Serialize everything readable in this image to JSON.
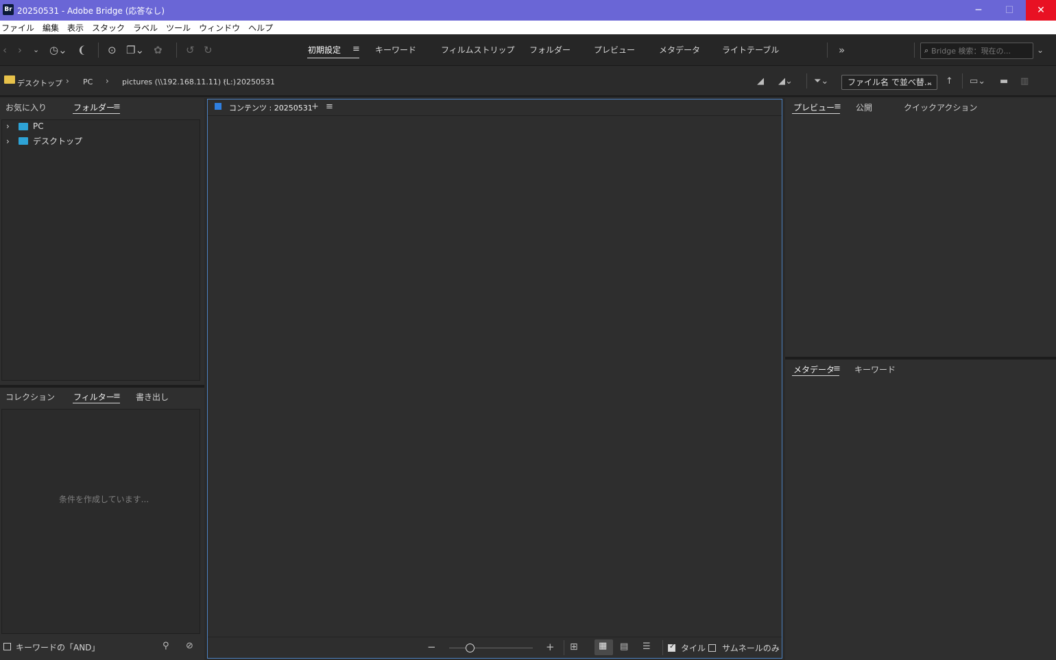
{
  "window": {
    "app_icon": "Br",
    "title": "20250531 - Adobe Bridge (応答なし)",
    "minimize": "─",
    "maximize": "☐",
    "close": "✕"
  },
  "menu": [
    "ファイル",
    "編集",
    "表示",
    "スタック",
    "ラベル",
    "ツール",
    "ウィンドウ",
    "ヘルプ"
  ],
  "workspaces": {
    "tabs": [
      "初期設定",
      "キーワード",
      "フィルムストリップ",
      "フォルダー",
      "プレビュー",
      "メタデータ",
      "ライトテーブル"
    ],
    "active": "初期設定",
    "more": "»"
  },
  "search": {
    "placeholder": "Bridge 検索：現在の..."
  },
  "breadcrumb": [
    "デスクトップ",
    "PC",
    "pictures (\\\\192.168.11.11) (L:)",
    "20250531"
  ],
  "sort": {
    "label": "ファイル名 で並べ替..."
  },
  "left_top_panel": {
    "tabs": [
      "お気に入り",
      "フォルダー"
    ],
    "active": "フォルダー",
    "tree": [
      {
        "label": "PC",
        "icon": "monitor-icon"
      },
      {
        "label": "デスクトップ",
        "icon": "desktop-icon"
      }
    ]
  },
  "left_bottom_panel": {
    "tabs": [
      "コレクション",
      "フィルター",
      "書き出し"
    ],
    "active": "フィルター",
    "status": "条件を作成しています...",
    "footer_checkbox": "キーワードの「AND」"
  },
  "content_panel": {
    "title": "コンテンツ : 20250531",
    "add": "+",
    "menu": "≡",
    "zoom_minus": "−",
    "zoom_plus": "+",
    "tile_checkbox": "タイル",
    "thumbnail_only_checkbox": "サムネールのみ",
    "tile_checked": true,
    "thumbnail_only_checked": false
  },
  "right_top_panel": {
    "tabs": [
      "プレビュー",
      "公開",
      "クイックアクション"
    ],
    "active": "プレビュー"
  },
  "right_bottom_panel": {
    "tabs": [
      "メタデータ",
      "キーワード"
    ],
    "active": "メタデータ"
  },
  "colors": {
    "titlebar": "#6a66d6",
    "close": "#e81123",
    "accent": "#4d83c4",
    "panel": "#2f2f2f"
  }
}
